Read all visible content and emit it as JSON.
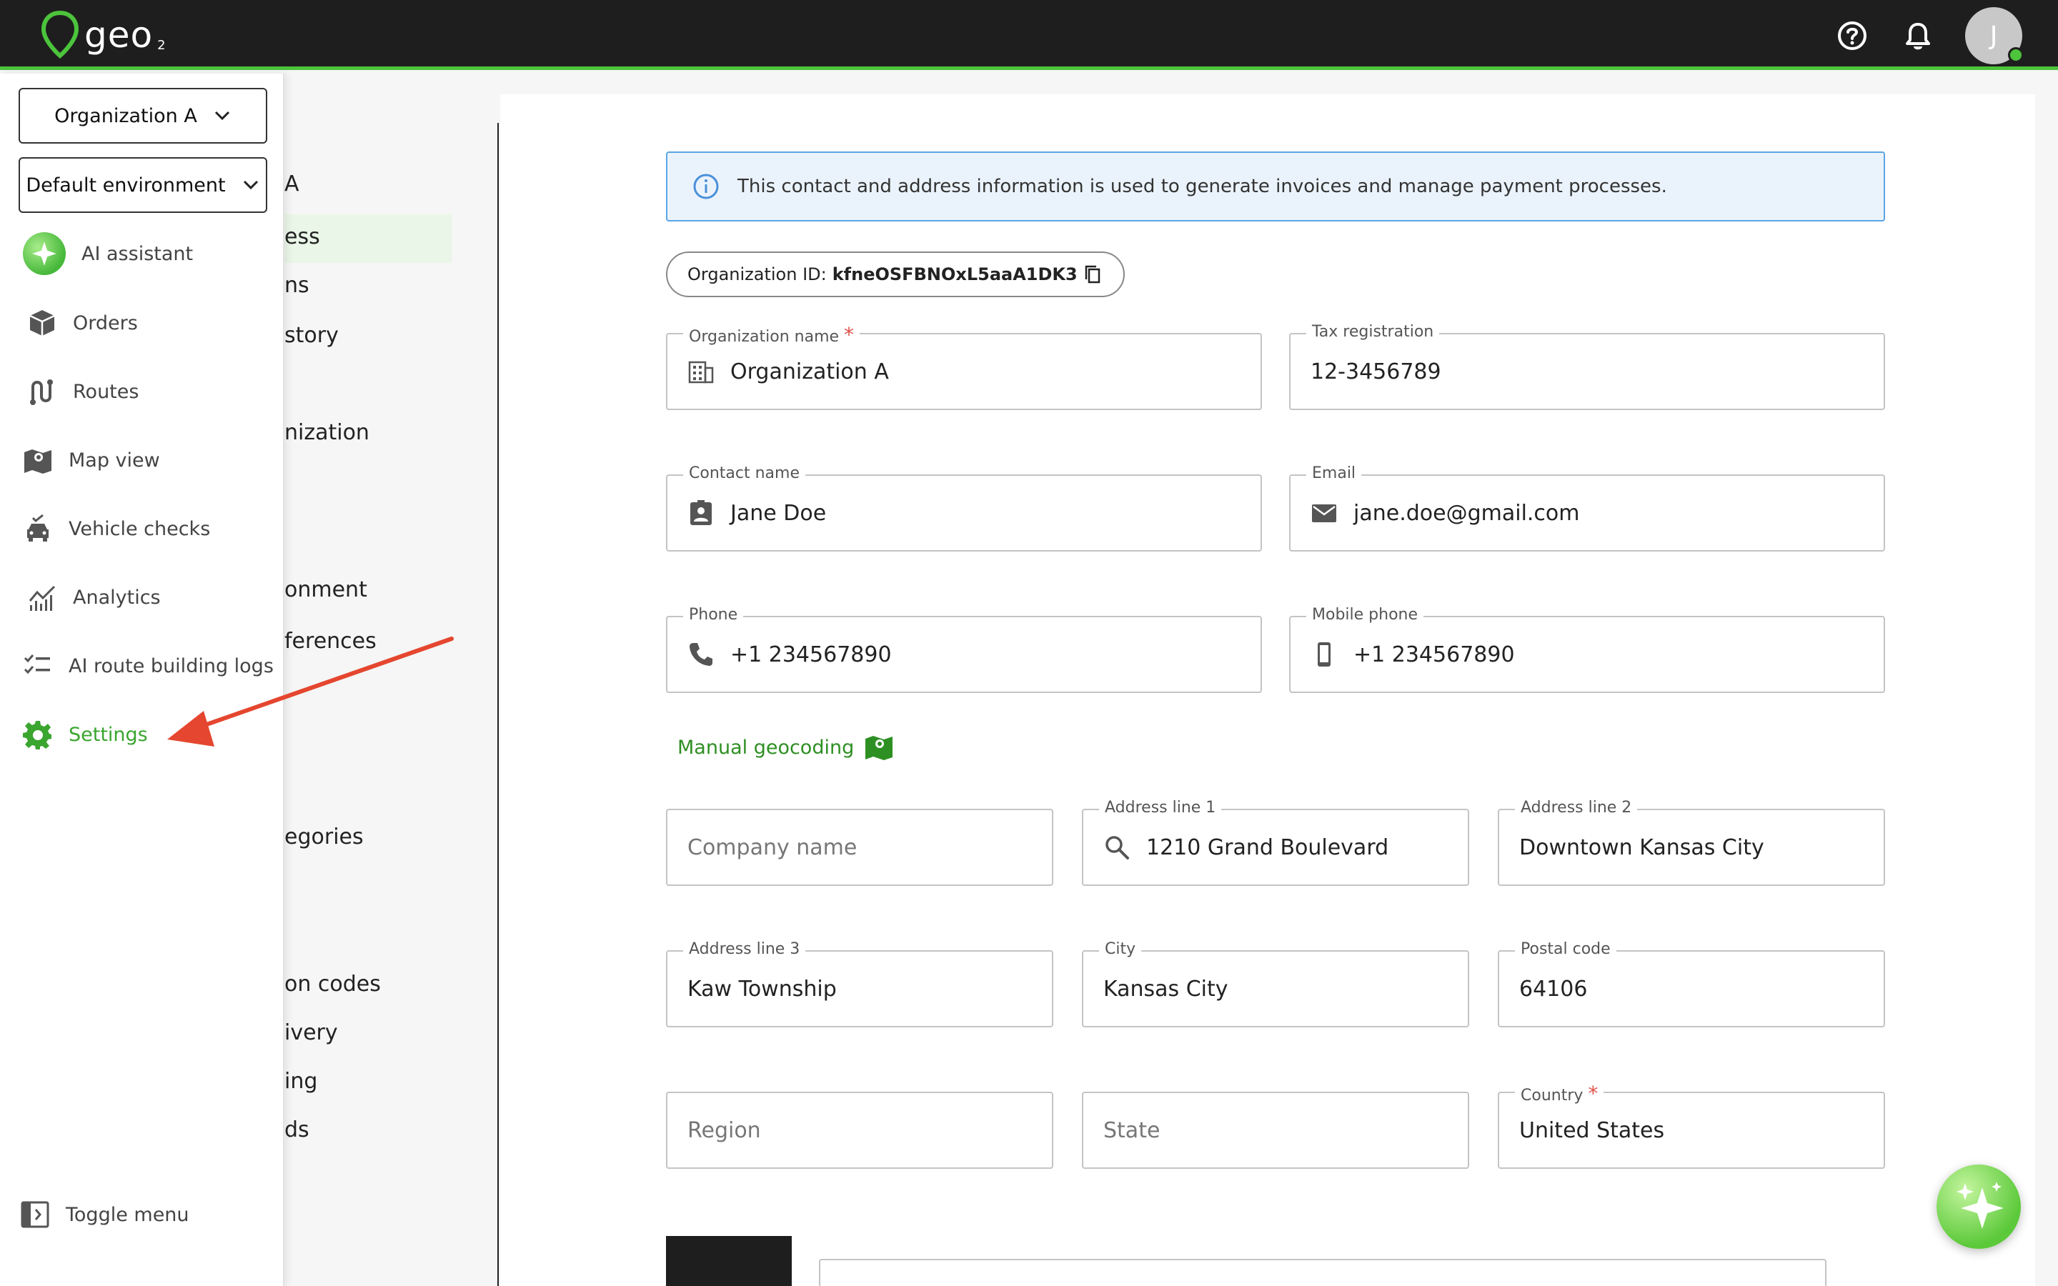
{
  "app": {
    "logo_text": "geo",
    "logo_sub": "2",
    "avatar_initial": "J"
  },
  "sidebar": {
    "org_dropdown": "Organization A",
    "env_dropdown": "Default environment",
    "items": [
      {
        "label": "AI assistant",
        "icon": "sparkle-icon"
      },
      {
        "label": "Orders",
        "icon": "package-icon"
      },
      {
        "label": "Routes",
        "icon": "route-icon"
      },
      {
        "label": "Map view",
        "icon": "map-icon"
      },
      {
        "label": "Vehicle checks",
        "icon": "vehicle-check-icon"
      },
      {
        "label": "Analytics",
        "icon": "analytics-icon"
      },
      {
        "label": "AI route building logs",
        "icon": "checklist-icon"
      },
      {
        "label": "Settings",
        "icon": "gear-icon"
      }
    ],
    "toggle_label": "Toggle menu"
  },
  "submenu": {
    "items": [
      "A",
      "ess",
      "ns",
      "story",
      "nization",
      "onment",
      "ferences",
      "egories",
      "on codes",
      "ivery",
      "ing",
      "ds"
    ]
  },
  "form": {
    "info_text": "This contact and address information is used to generate invoices and manage payment processes.",
    "org_id_label": "Organization ID:",
    "org_id_value": "kfneOSFBNOxL5aaA1DK3",
    "org_name": {
      "label": "Organization name",
      "required": "*",
      "value": "Organization A"
    },
    "tax": {
      "label": "Tax registration",
      "value": "12-3456789"
    },
    "contact": {
      "label": "Contact name",
      "value": "Jane Doe"
    },
    "email": {
      "label": "Email",
      "value": "jane.doe@gmail.com"
    },
    "phone": {
      "label": "Phone",
      "value": "+1 234567890"
    },
    "mobile": {
      "label": "Mobile phone",
      "value": "+1 234567890"
    },
    "geocoding_label": "Manual geocoding",
    "company": {
      "placeholder": "Company name"
    },
    "address1": {
      "label": "Address line 1",
      "value": "1210 Grand Boulevard"
    },
    "address2": {
      "label": "Address line 2",
      "value": "Downtown Kansas City"
    },
    "address3": {
      "label": "Address line 3",
      "value": "Kaw Township"
    },
    "city": {
      "label": "City",
      "value": "Kansas City"
    },
    "postal": {
      "label": "Postal code",
      "value": "64106"
    },
    "region": {
      "placeholder": "Region"
    },
    "state": {
      "placeholder": "State"
    },
    "country": {
      "label": "Country",
      "required": "*",
      "value": "United States"
    }
  },
  "colors": {
    "accent": "#4cc43c",
    "active_text": "#3aa52f",
    "topbar": "#1e1e1e",
    "info_border": "#5aa5e6",
    "arrow": "#e5462f"
  }
}
